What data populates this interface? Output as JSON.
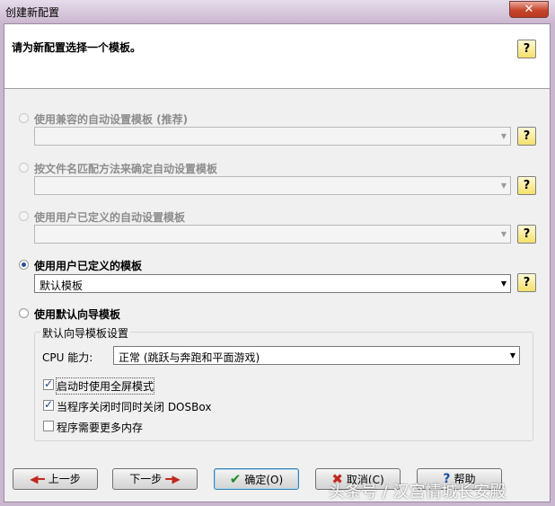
{
  "window": {
    "title": "创建新配置",
    "close": "✕"
  },
  "header": {
    "prompt": "请为新配置选择一个模板。",
    "help": "?"
  },
  "options": [
    {
      "label": "使用兼容的自动设置模板 (推荐)",
      "combo": "",
      "enabled": false,
      "selected": false
    },
    {
      "label": "按文件名匹配方法来确定自动设置模板",
      "combo": "",
      "enabled": false,
      "selected": false
    },
    {
      "label": "使用用户已定义的自动设置模板",
      "combo": "",
      "enabled": false,
      "selected": false
    },
    {
      "label": "使用用户已定义的模板",
      "combo": "默认模板",
      "enabled": true,
      "selected": true
    },
    {
      "label": "使用默认向导模板",
      "enabled": true,
      "selected": false
    }
  ],
  "wizard_group": {
    "legend": "默认向导模板设置",
    "cpu_label": "CPU 能力:",
    "cpu_value": "正常 (跳跃与奔跑和平面游戏)",
    "checks": [
      {
        "label": "启动时使用全屏模式",
        "checked": true
      },
      {
        "label": "当程序关闭时同时关闭 DOSBox",
        "checked": true
      },
      {
        "label": "程序需要更多内存",
        "checked": false
      }
    ]
  },
  "buttons": {
    "prev": "上一步",
    "next": "下一步",
    "ok": "确定(O)",
    "cancel": "取消(C)",
    "help": "帮助"
  },
  "watermark": "头条号 / 汉宫情城长安殿"
}
